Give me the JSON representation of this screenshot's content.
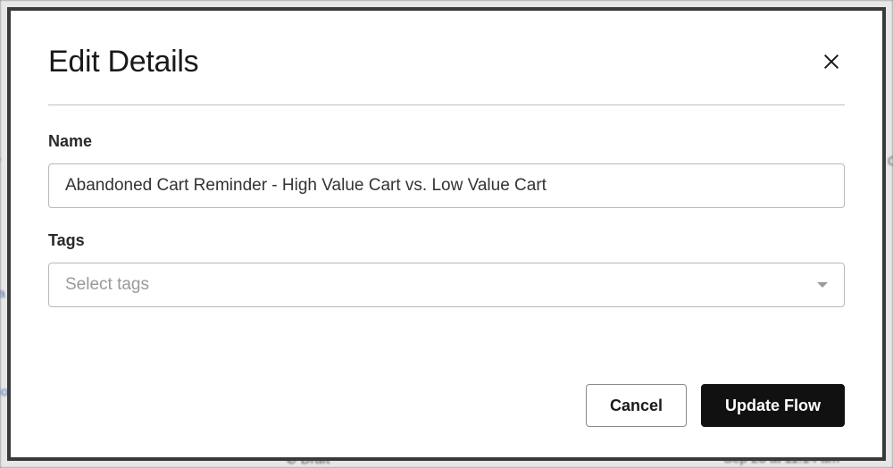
{
  "dialog": {
    "title": "Edit Details",
    "name_label": "Name",
    "name_value": "Abandoned Cart Reminder - High Value Cart vs. Low Value Cart",
    "tags_label": "Tags",
    "tags_placeholder": "Select tags",
    "cancel_label": "Cancel",
    "submit_label": "Update Flow"
  }
}
